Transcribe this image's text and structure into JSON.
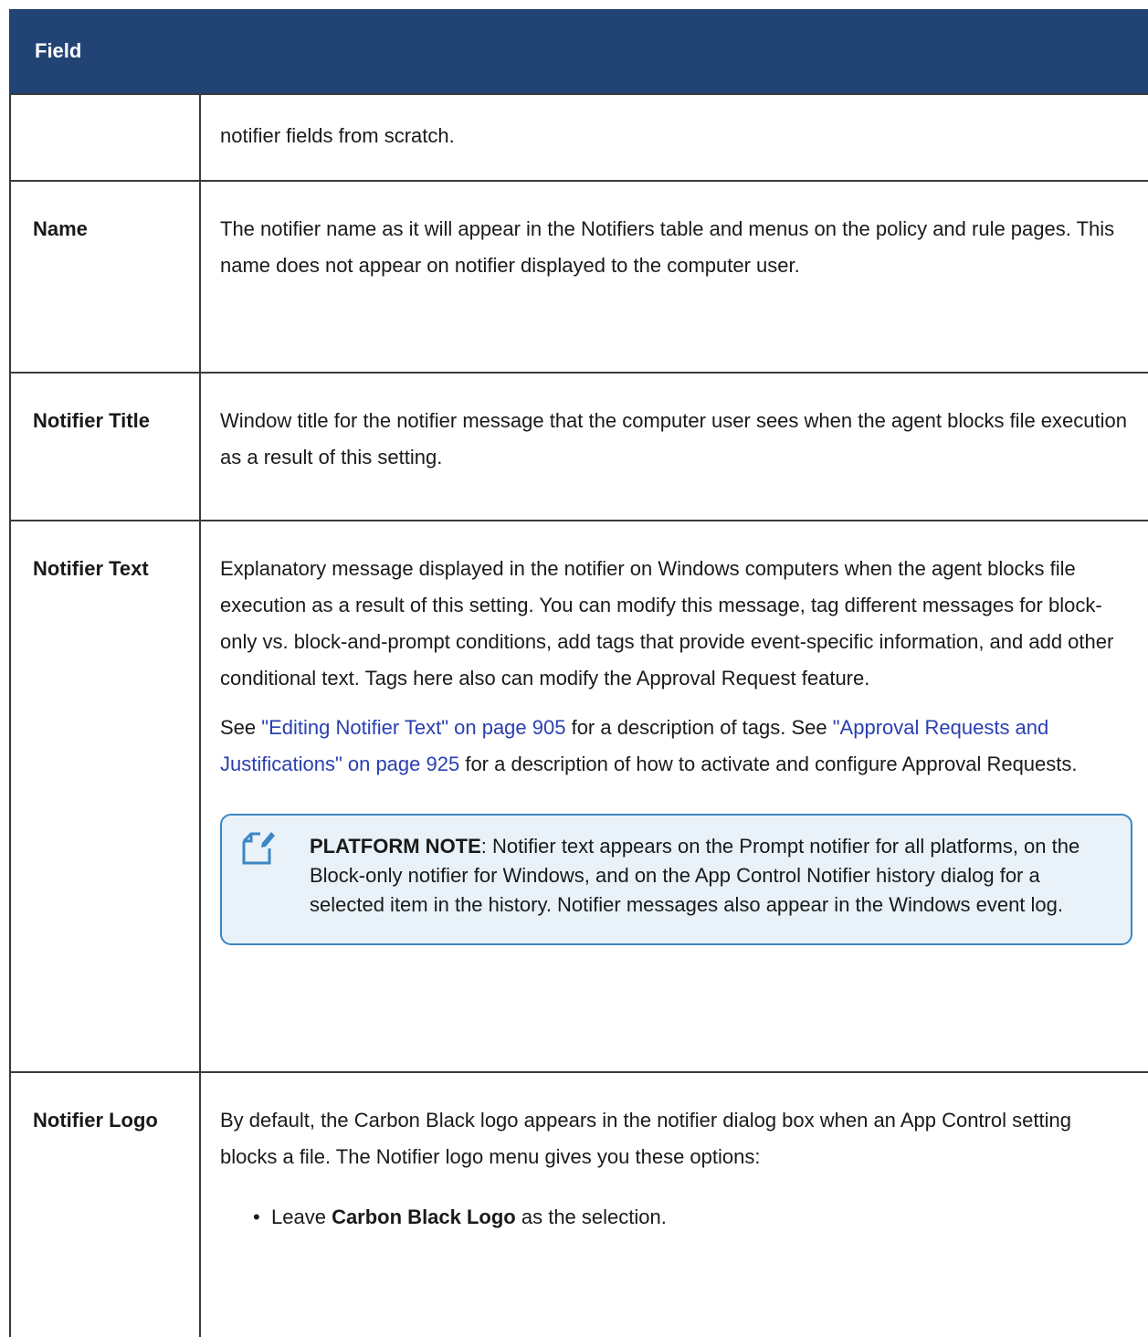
{
  "table": {
    "header": {
      "field": "Field",
      "description": ""
    },
    "rows": [
      {
        "field": "",
        "paragraphs": [
          "notifier fields from scratch."
        ]
      },
      {
        "field": "Name",
        "paragraphs": [
          "The notifier name as it will appear in the Notifiers table and menus on the policy and rule pages. This name does not appear on notifier displayed to the computer user."
        ]
      },
      {
        "field": "Notifier Title",
        "paragraphs": [
          "Window title for the notifier message that the computer user sees when the agent blocks file execution as a result of this setting."
        ]
      },
      {
        "field": "Notifier Text",
        "paragraph1": "Explanatory message displayed in the notifier on Windows computers when the agent blocks file execution as a result of this setting. You can modify this message, tag different messages for block-only vs. block-and-prompt conditions, add tags that provide event-specific information, and add other conditional text. Tags here also can modify the Approval Request feature.",
        "p2_see": "See ",
        "p2_link1": "\"Editing Notifier Text\" on page 905",
        "p2_mid": " for a description of tags. See ",
        "p2_link2": "\"Approval Requests and Justifications\" on page 925",
        "p2_end": " for a description of how to activate and configure Approval Requests.",
        "note_label": "PLATFORM NOTE",
        "note_text": ": Notifier text appears on the Prompt notifier for all platforms, on the Block-only notifier for Windows, and on the App Control Notifier history dialog for a selected item in the history. Notifier messages also appear in the Windows event log."
      },
      {
        "field": "Notifier Logo",
        "paragraph1": "By default, the Carbon Black logo appears in the notifier dialog box when an App Control setting blocks a file. The Notifier logo menu gives you these options:",
        "bullet_prefix": "Leave ",
        "bullet_bold": "Carbon Black Logo",
        "bullet_suffix": " as the selection."
      }
    ]
  },
  "icons": {
    "note": "note-edit-icon"
  },
  "colors": {
    "header_bg": "#214475",
    "link": "#2a3fb1",
    "note_border": "#3c86c3",
    "note_bg": "#e9f2f8"
  }
}
